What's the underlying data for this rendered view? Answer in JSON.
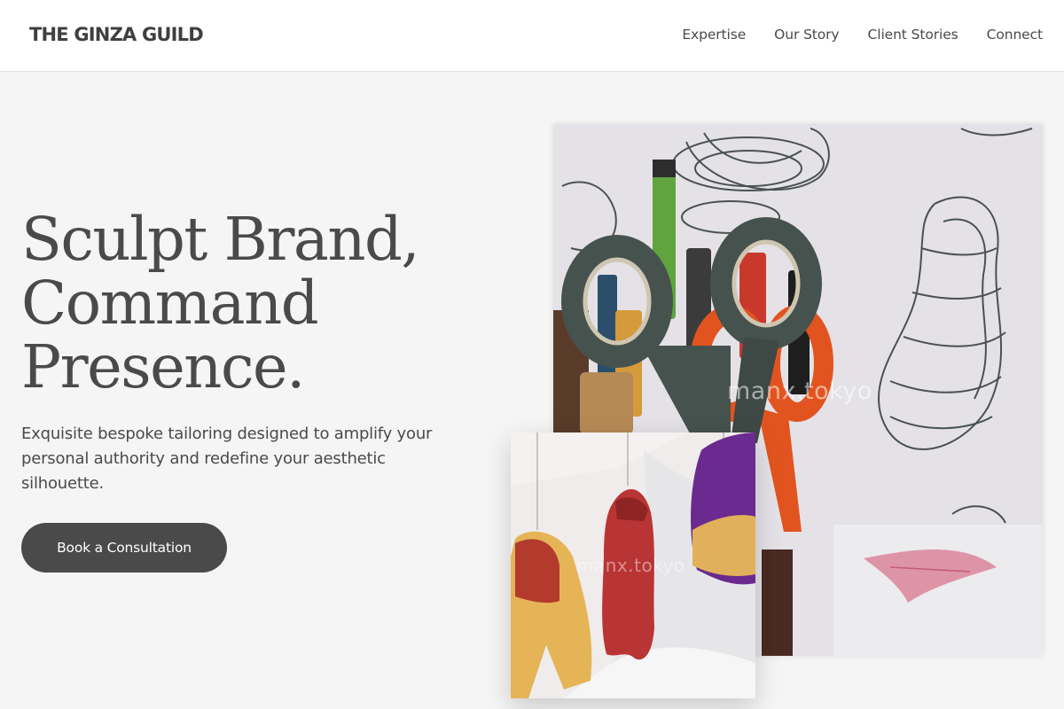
{
  "header": {
    "brand": "THE GINZA GUILD",
    "nav": [
      "Expertise",
      "Our Story",
      "Client Stories",
      "Connect"
    ]
  },
  "hero": {
    "headline_lines": [
      "Sculpt Brand,",
      "Command",
      "Presence."
    ],
    "subtext": "Exquisite bespoke tailoring designed to amplify your personal authority and redefine your aesthetic silhouette.",
    "cta_label": "Book a Consultation"
  },
  "images": {
    "main_watermark": "manx.tokyo",
    "small_watermark": "manx.tokyo"
  },
  "colors": {
    "page_bg": "#f5f5f5",
    "text": "#4a4a4a",
    "button_bg": "#4a4a4a",
    "button_text": "#ffffff"
  }
}
